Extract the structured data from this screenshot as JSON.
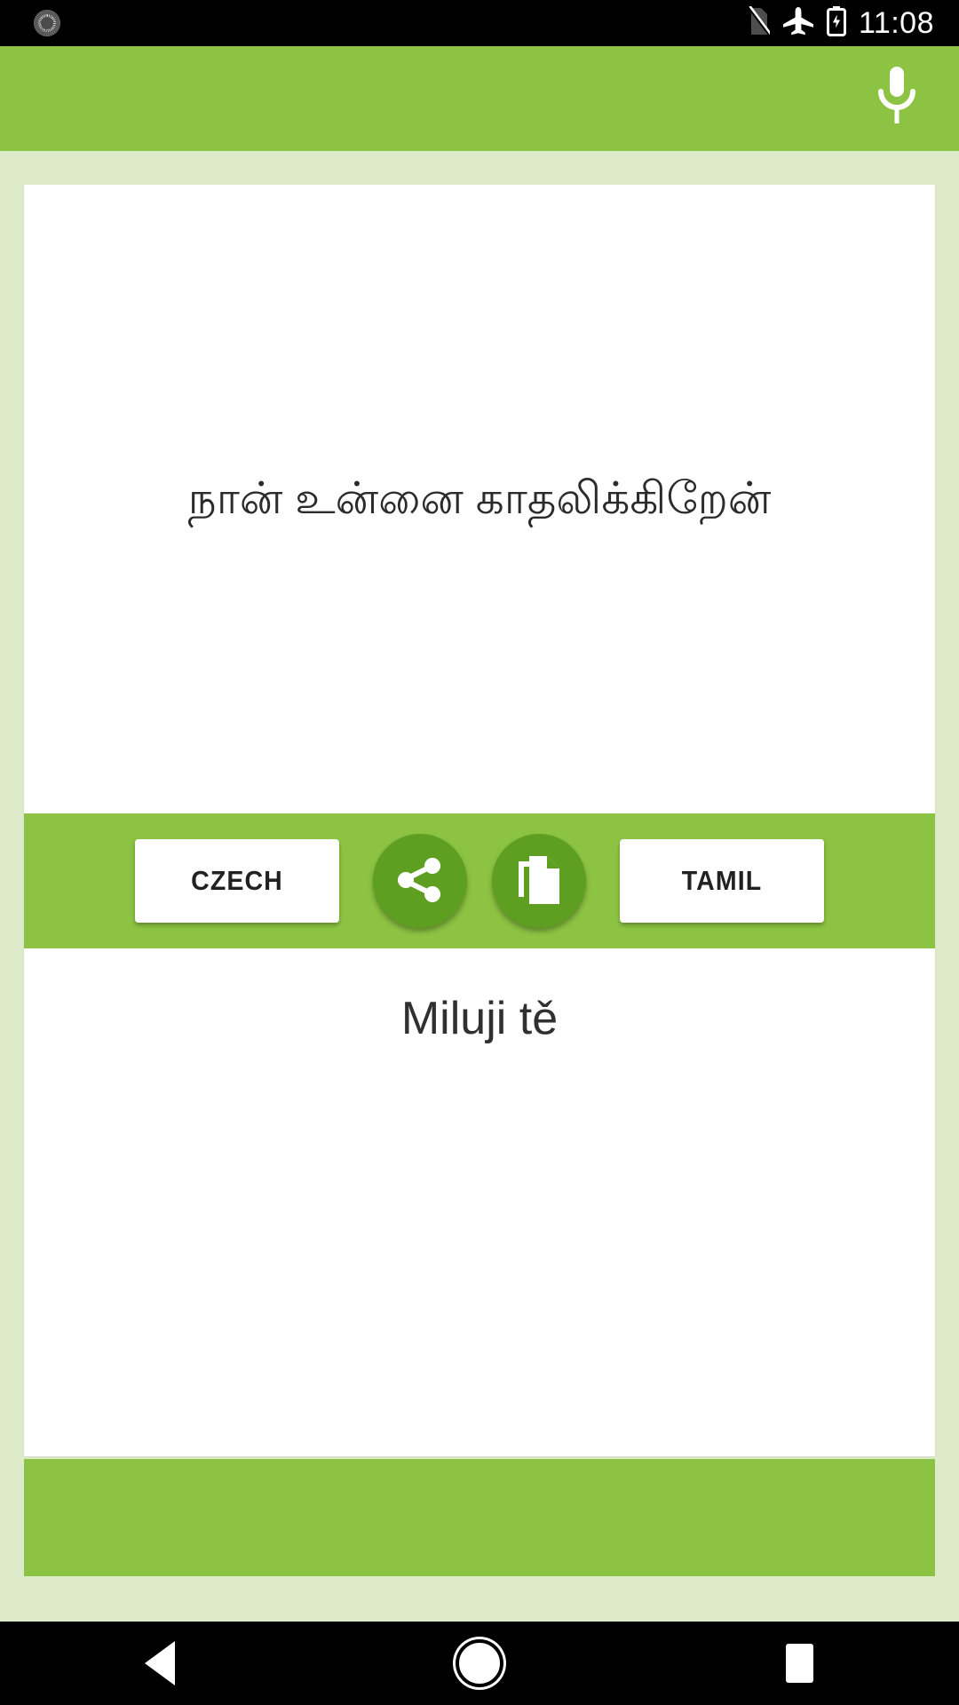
{
  "status_bar": {
    "notification_icon": "alarm-clock-icon",
    "icons": [
      "no-sim-icon",
      "airplane-mode-icon",
      "battery-charging-icon"
    ],
    "time": "11:08"
  },
  "app_bar": {
    "mic_icon": "microphone-icon",
    "background_color": "#8CC342"
  },
  "translator": {
    "source": {
      "text": "நான் உன்னை காதலிக்கிறேன்",
      "language_label": "TAMIL"
    },
    "target": {
      "text": "Miluji tě",
      "language_label": "CZECH"
    },
    "toolbar": {
      "left_language_button": "CZECH",
      "right_language_button": "TAMIL",
      "share_icon": "share-icon",
      "copy_icon": "copy-icon",
      "button_color": "#5E9E20",
      "bar_color": "#8CC342"
    }
  },
  "ad_placeholder": {
    "label": "",
    "color": "#8CC342"
  },
  "nav_bar": {
    "back": "back-icon",
    "home": "home-icon",
    "recents": "recents-icon"
  },
  "theme": {
    "page_background": "#DDEBCA",
    "accent": "#8CC342",
    "accent_dark": "#5E9E20"
  }
}
